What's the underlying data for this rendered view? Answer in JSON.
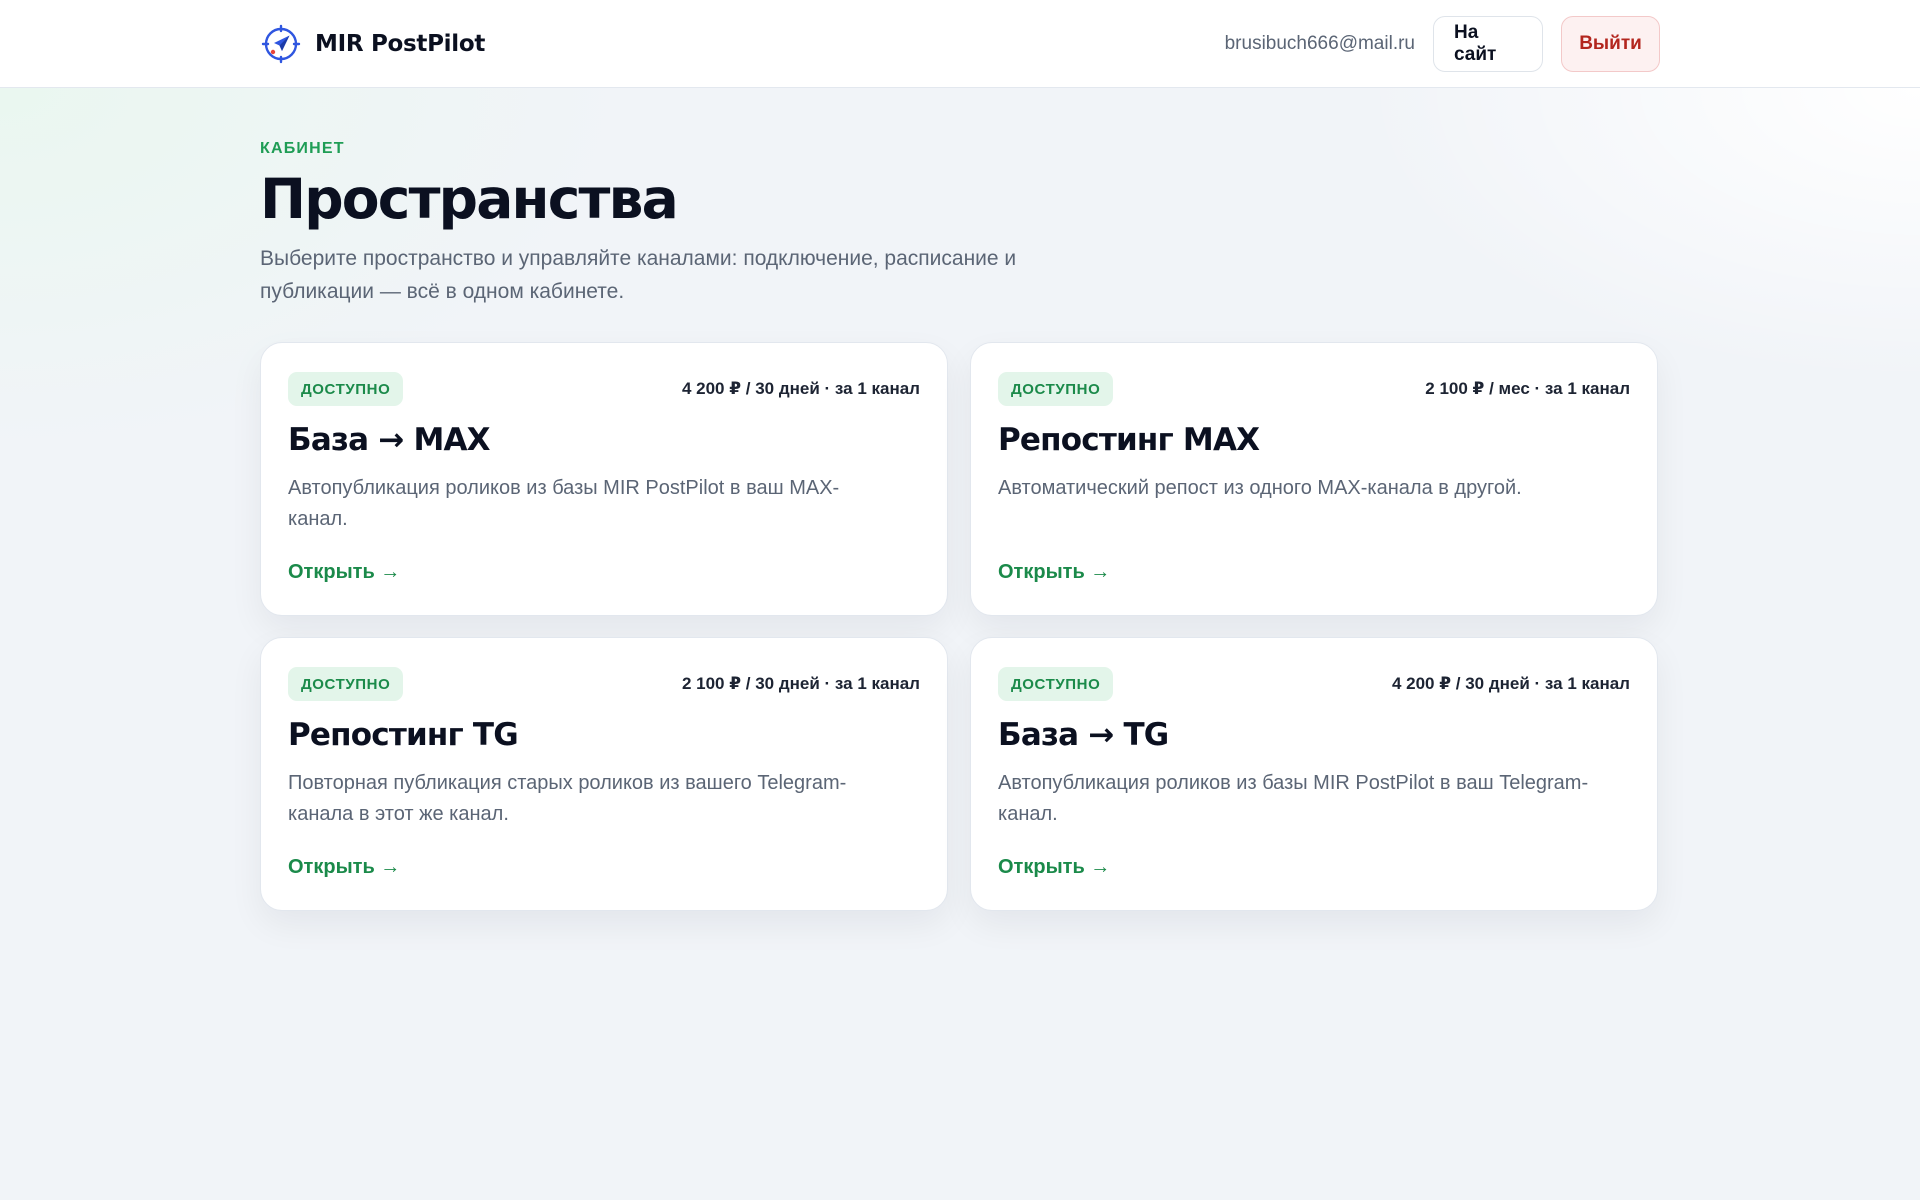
{
  "header": {
    "brand": "MIR PostPilot",
    "email": "brusibuch666@mail.ru",
    "site_button": "На сайт",
    "logout_button": "Выйти"
  },
  "page": {
    "eyebrow": "КАБИНЕТ",
    "title": "Пространства",
    "description": "Выберите пространство и управляйте каналами: подключение, расписание и публикации — всё в одном кабинете."
  },
  "cards": [
    {
      "badge": "ДОСТУПНО",
      "price": "4 200 ₽ / 30 дней · за 1 канал",
      "title": "База → MAX",
      "description": "Автопубликация роликов из базы MIR PostPilot в ваш MAX-канал.",
      "link": "Открыть →"
    },
    {
      "badge": "ДОСТУПНО",
      "price": "2 100 ₽ / мес · за 1 канал",
      "title": "Репостинг MAX",
      "description": "Автоматический репост из одного MAX-канала в другой.",
      "link": "Открыть →"
    },
    {
      "badge": "ДОСТУПНО",
      "price": "2 100 ₽ / 30 дней · за 1 канал",
      "title": "Репостинг TG",
      "description": "Повторная публикация старых роликов из вашего Telegram-канала в этот же канал.",
      "link": "Открыть →"
    },
    {
      "badge": "ДОСТУПНО",
      "price": "4 200 ₽ / 30 дней · за 1 канал",
      "title": "База → TG",
      "description": "Автопубликация роликов из базы MIR PostPilot в ваш Telegram-канал.",
      "link": "Открыть →"
    }
  ],
  "colors": {
    "accent": "#1b8a4a",
    "danger": "#b3261e",
    "logo_blue": "#2f56e0",
    "logo_red": "#e8443a"
  },
  "icons": {
    "logo": "compass-plane-icon"
  }
}
